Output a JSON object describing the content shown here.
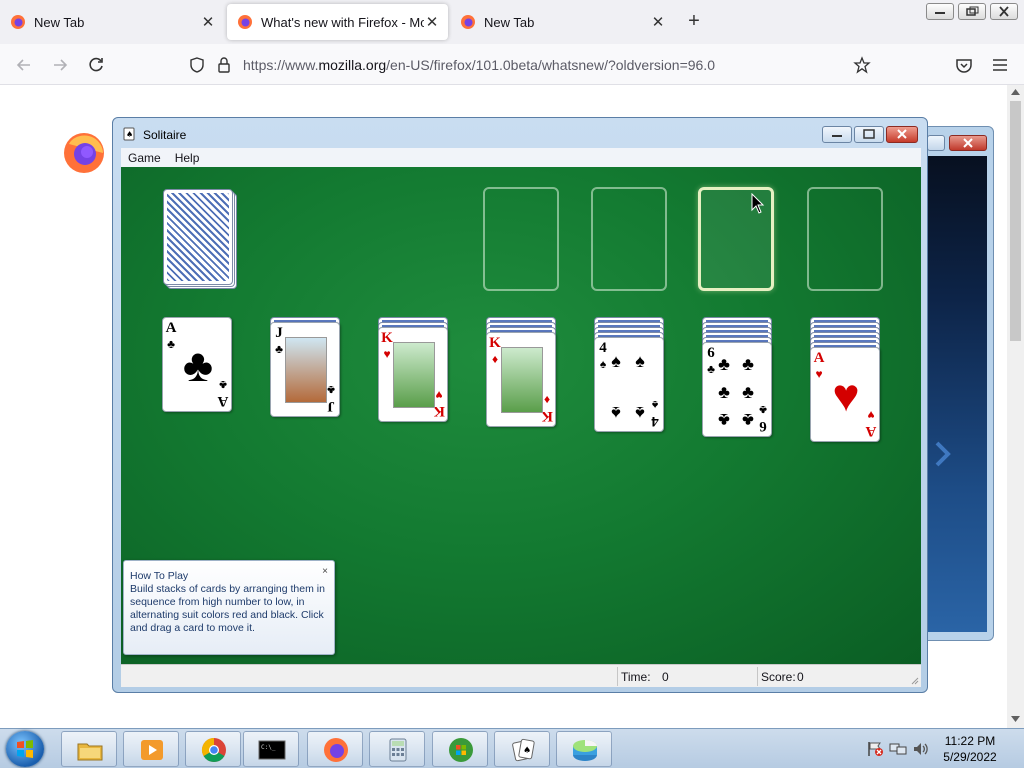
{
  "browser": {
    "tabs": [
      {
        "label": "New Tab",
        "active": false
      },
      {
        "label": "What's new with Firefox - More",
        "active": true
      },
      {
        "label": "New Tab",
        "active": false
      }
    ],
    "new_tab_symbol": "+",
    "close_symbol": "✕",
    "url": {
      "prefix": "https://www.",
      "domain": "mozilla.org",
      "path": "/en-US/firefox/101.0beta/whatsnew/?oldversion=96.0"
    }
  },
  "solitaire": {
    "title": "Solitaire",
    "menu": [
      "Game",
      "Help"
    ],
    "status": {
      "time_label": "Time:",
      "time_value": "0",
      "score_label": "Score:",
      "score_value": "0"
    },
    "tableau": [
      {
        "hidden": 0,
        "card": {
          "rank": "A",
          "suit": "♣",
          "color": "black"
        }
      },
      {
        "hidden": 1,
        "card": {
          "rank": "J",
          "suit": "♣",
          "color": "black"
        }
      },
      {
        "hidden": 2,
        "card": {
          "rank": "K",
          "suit": "♥",
          "color": "red"
        }
      },
      {
        "hidden": 3,
        "card": {
          "rank": "K",
          "suit": "♦",
          "color": "red"
        }
      },
      {
        "hidden": 4,
        "card": {
          "rank": "4",
          "suit": "♠",
          "color": "black"
        }
      },
      {
        "hidden": 5,
        "card": {
          "rank": "6",
          "suit": "♣",
          "color": "black"
        }
      },
      {
        "hidden": 6,
        "card": {
          "rank": "A",
          "suit": "♥",
          "color": "red"
        }
      }
    ],
    "foundations": 4,
    "highlighted_foundation": 3,
    "how_to_play": {
      "title": "How To Play",
      "text": "Build stacks of cards by arranging them in sequence from high number to low, in alternating suit colors red and black. Click and drag a card to move it.",
      "close": "×"
    }
  },
  "taskbar": {
    "time": "11:22 PM",
    "date": "5/29/2022"
  },
  "colors": {
    "felt": "#137a31",
    "tab_strip": "#f0f0f4",
    "taskbar": "#b6cbe2"
  }
}
